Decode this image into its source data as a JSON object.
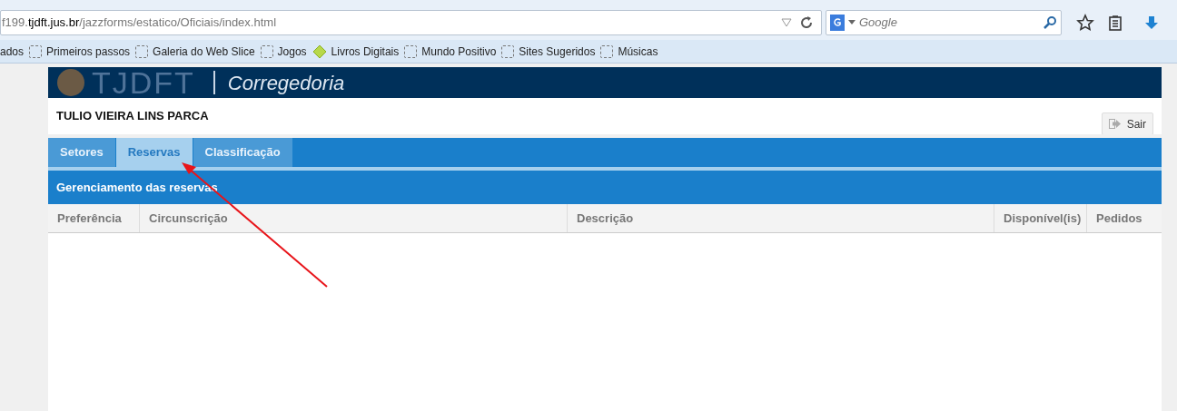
{
  "browser": {
    "url_prefix": "f199.",
    "url_host": "tjdft.jus.br",
    "url_path": "/jazzforms/estatico/Oficiais/index.html",
    "search_placeholder": "Google",
    "bookmarks": [
      {
        "label": "ados",
        "kind": "plain"
      },
      {
        "label": "Primeiros passos",
        "kind": "folder"
      },
      {
        "label": "Galeria do Web Slice",
        "kind": "folder"
      },
      {
        "label": "Jogos",
        "kind": "folder"
      },
      {
        "label": "Livros Digitais",
        "kind": "app"
      },
      {
        "label": "Mundo Positivo",
        "kind": "folder"
      },
      {
        "label": "Sites Sugeridos",
        "kind": "folder"
      },
      {
        "label": "Músicas",
        "kind": "folder"
      }
    ]
  },
  "banner": {
    "logo": "TJDFT",
    "title": "Corregedoria"
  },
  "user": {
    "name": "TULIO VIEIRA LINS PARCA",
    "logout": "Sair"
  },
  "tabs": [
    {
      "label": "Setores",
      "selected": false
    },
    {
      "label": "Reservas",
      "selected": true
    },
    {
      "label": "Classificação",
      "selected": false
    }
  ],
  "section": {
    "title": "Gerenciamento das reservas"
  },
  "table": {
    "columns": [
      "Preferência",
      "Circunscrição",
      "Descrição",
      "Disponível(is)",
      "Pedidos"
    ]
  }
}
